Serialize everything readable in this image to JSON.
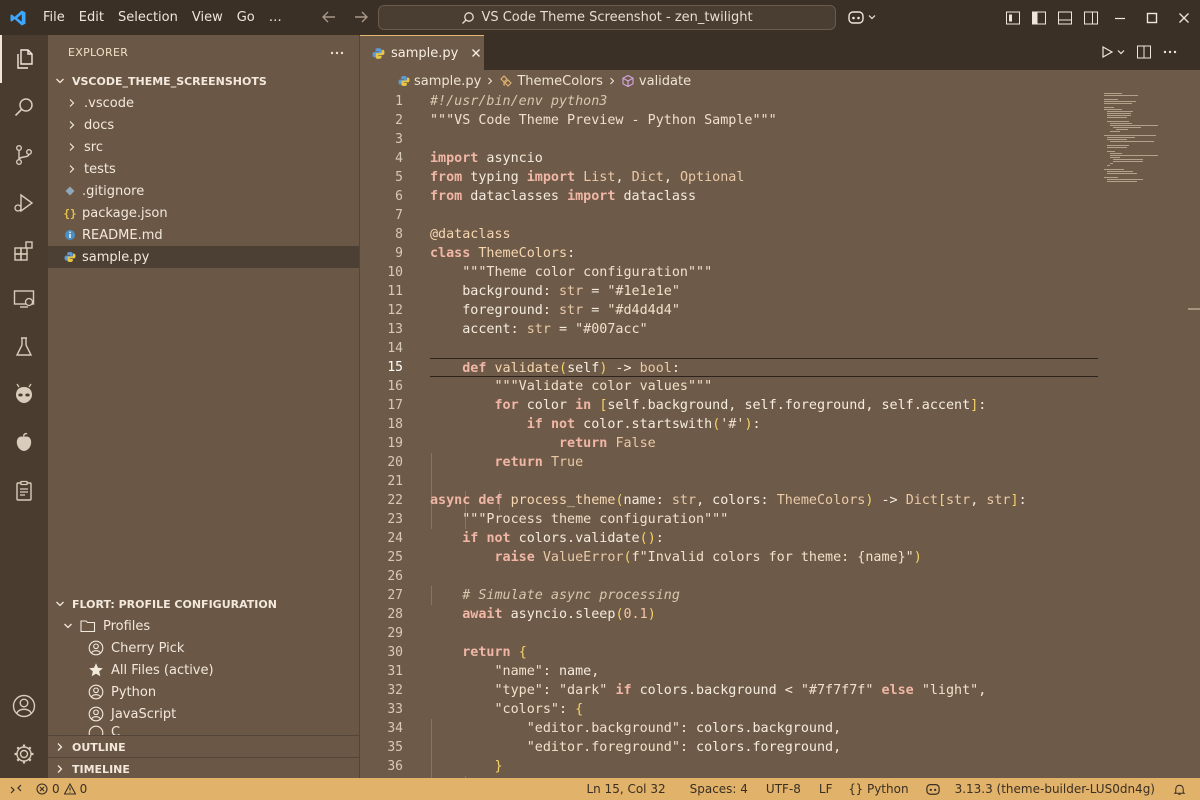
{
  "titlebar": {
    "menu": [
      "File",
      "Edit",
      "Selection",
      "View",
      "Go",
      "…"
    ],
    "search_text": "VS Code Theme Screenshot - zen_twilight"
  },
  "explorer": {
    "title": "EXPLORER",
    "root": "VSCODE_THEME_SCREENSHOTS",
    "folders": [
      ".vscode",
      "docs",
      "src",
      "tests"
    ],
    "files": [
      ".gitignore",
      "package.json",
      "README.md",
      "sample.py"
    ],
    "selected": "sample.py"
  },
  "profiles_panel": {
    "title": "FLORT: PROFILE CONFIGURATION",
    "folder": "Profiles",
    "items": [
      "Cherry Pick",
      "All Files (active)",
      "Python",
      "JavaScript",
      "C"
    ]
  },
  "outline": "OUTLINE",
  "timeline": "TIMELINE",
  "editor": {
    "tab_name": "sample.py",
    "breadcrumbs": [
      "sample.py",
      "ThemeColors",
      "validate"
    ],
    "current_line": 15
  },
  "code_lines": [
    "#!/usr/bin/env python3",
    "\"\"\"VS Code Theme Preview - Python Sample\"\"\"",
    "",
    "import asyncio",
    "from typing import List, Dict, Optional",
    "from dataclasses import dataclass",
    "",
    "@dataclass",
    "class ThemeColors:",
    "    \"\"\"Theme color configuration\"\"\"",
    "    background: str = \"#1e1e1e\"",
    "    foreground: str = \"#d4d4d4\"",
    "    accent: str = \"#007acc\"",
    "",
    "    def validate(self) -> bool:",
    "        \"\"\"Validate color values\"\"\"",
    "        for color in [self.background, self.foreground, self.accent]:",
    "            if not color.startswith('#'):",
    "                return False",
    "        return True",
    "",
    "async def process_theme(name: str, colors: ThemeColors) -> Dict[str, str]:",
    "    \"\"\"Process theme configuration\"\"\"",
    "    if not colors.validate():",
    "        raise ValueError(f\"Invalid colors for theme: {name}\")",
    "",
    "    # Simulate async processing",
    "    await asyncio.sleep(0.1)",
    "",
    "    return {",
    "        \"name\": name,",
    "        \"type\": \"dark\" if colors.background < \"#7f7f7f\" else \"light\",",
    "        \"colors\": {",
    "            \"editor.background\": colors.background,",
    "            \"editor.foreground\": colors.foreground,",
    "        }"
  ],
  "statusbar": {
    "errors": "0",
    "warnings": "0",
    "position": "Ln 15, Col 32",
    "spaces": "Spaces: 4",
    "encoding": "UTF-8",
    "eol": "LF",
    "language": "Python",
    "interpreter": "3.13.3 (theme-builder-LUS0dn4g)"
  },
  "colors": {
    "titlebar": "#3b3025",
    "activitybar": "#4a3d30",
    "sidebar": "#6b5746",
    "editor": "#6e5a48",
    "statusbar": "#e0b26a",
    "accent": "#e6b673"
  }
}
